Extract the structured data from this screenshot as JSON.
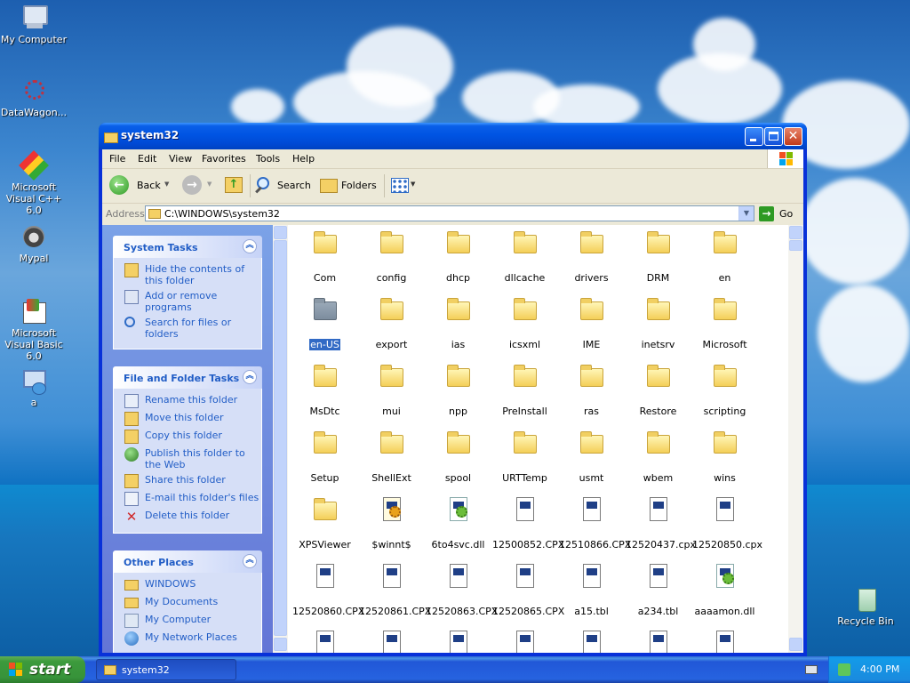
{
  "desktop": {
    "icons": [
      {
        "label": "My Computer"
      },
      {
        "label": "DataWagon..."
      },
      {
        "label": "Microsoft Visual C++ 6.0"
      },
      {
        "label": "Mypal"
      },
      {
        "label": "Microsoft Visual Basic 6.0"
      },
      {
        "label": "a"
      },
      {
        "label": "Recycle Bin"
      }
    ]
  },
  "window": {
    "title": "system32",
    "menu": [
      "File",
      "Edit",
      "View",
      "Favorites",
      "Tools",
      "Help"
    ],
    "toolbar": {
      "back": "Back",
      "search": "Search",
      "folders": "Folders"
    },
    "address": {
      "label": "Address",
      "value": "C:\\WINDOWS\\system32",
      "go": "Go"
    }
  },
  "sidebar": {
    "system_tasks": {
      "title": "System Tasks",
      "items": [
        "Hide the contents of this folder",
        "Add or remove programs",
        "Search for files or folders"
      ]
    },
    "file_tasks": {
      "title": "File and Folder Tasks",
      "items": [
        "Rename this folder",
        "Move this folder",
        "Copy this folder",
        "Publish this folder to the Web",
        "Share this folder",
        "E-mail this folder's files",
        "Delete this folder"
      ]
    },
    "other_places": {
      "title": "Other Places",
      "items": [
        "WINDOWS",
        "My Documents",
        "My Computer",
        "My Network Places"
      ]
    }
  },
  "files": [
    {
      "name": "Com",
      "kind": "folder"
    },
    {
      "name": "config",
      "kind": "folder"
    },
    {
      "name": "dhcp",
      "kind": "folder"
    },
    {
      "name": "dllcache",
      "kind": "folder"
    },
    {
      "name": "drivers",
      "kind": "folder"
    },
    {
      "name": "DRM",
      "kind": "folder"
    },
    {
      "name": "en",
      "kind": "folder"
    },
    {
      "name": "en-US",
      "kind": "folder",
      "selected": true
    },
    {
      "name": "export",
      "kind": "folder"
    },
    {
      "name": "ias",
      "kind": "folder"
    },
    {
      "name": "icsxml",
      "kind": "folder"
    },
    {
      "name": "IME",
      "kind": "folder"
    },
    {
      "name": "inetsrv",
      "kind": "folder"
    },
    {
      "name": "Microsoft",
      "kind": "folder"
    },
    {
      "name": "MsDtc",
      "kind": "folder"
    },
    {
      "name": "mui",
      "kind": "folder"
    },
    {
      "name": "npp",
      "kind": "folder"
    },
    {
      "name": "PreInstall",
      "kind": "folder"
    },
    {
      "name": "ras",
      "kind": "folder"
    },
    {
      "name": "Restore",
      "kind": "folder"
    },
    {
      "name": "scripting",
      "kind": "folder"
    },
    {
      "name": "Setup",
      "kind": "folder"
    },
    {
      "name": "ShellExt",
      "kind": "folder"
    },
    {
      "name": "spool",
      "kind": "folder"
    },
    {
      "name": "URTTemp",
      "kind": "folder"
    },
    {
      "name": "usmt",
      "kind": "folder"
    },
    {
      "name": "wbem",
      "kind": "folder"
    },
    {
      "name": "wins",
      "kind": "folder"
    },
    {
      "name": "XPSViewer",
      "kind": "folder"
    },
    {
      "name": "$winnt$",
      "kind": "settings"
    },
    {
      "name": "6to4svc.dll",
      "kind": "dll"
    },
    {
      "name": "12500852.CPX",
      "kind": "file"
    },
    {
      "name": "12510866.CPX",
      "kind": "file"
    },
    {
      "name": "12520437.cpx",
      "kind": "file"
    },
    {
      "name": "12520850.cpx",
      "kind": "file"
    },
    {
      "name": "12520860.CPX",
      "kind": "file"
    },
    {
      "name": "12520861.CPX",
      "kind": "file"
    },
    {
      "name": "12520863.CPX",
      "kind": "file"
    },
    {
      "name": "12520865.CPX",
      "kind": "file"
    },
    {
      "name": "a15.tbl",
      "kind": "file"
    },
    {
      "name": "a234.tbl",
      "kind": "file"
    },
    {
      "name": "aaaamon.dll",
      "kind": "dll"
    }
  ],
  "taskbar": {
    "start": "start",
    "task": "system32",
    "clock": "4:00 PM"
  }
}
